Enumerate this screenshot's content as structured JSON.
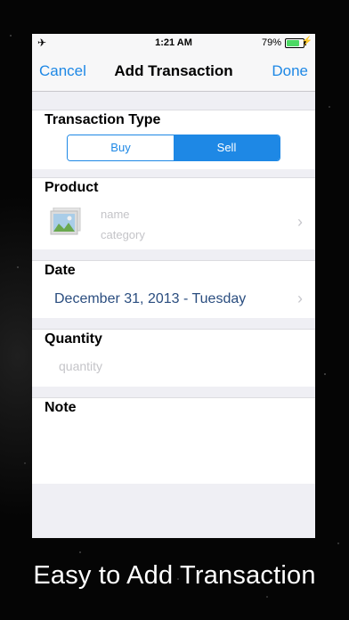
{
  "status_bar": {
    "time": "1:21 AM",
    "battery_percent": "79%",
    "battery_level": 0.79
  },
  "nav": {
    "cancel_label": "Cancel",
    "title": "Add Transaction",
    "done_label": "Done"
  },
  "transaction_type": {
    "header": "Transaction Type",
    "options": [
      "Buy",
      "Sell"
    ],
    "selected": "Sell"
  },
  "product": {
    "header": "Product",
    "name_placeholder": "name",
    "category_placeholder": "category"
  },
  "date": {
    "header": "Date",
    "value": "December 31, 2013 - Tuesday"
  },
  "quantity": {
    "header": "Quantity",
    "placeholder": "quantity"
  },
  "note": {
    "header": "Note"
  },
  "caption": "Easy to Add Transaction",
  "colors": {
    "accent": "#1e88e5",
    "date_text": "#2a4d7f",
    "battery": "#4cd964"
  }
}
